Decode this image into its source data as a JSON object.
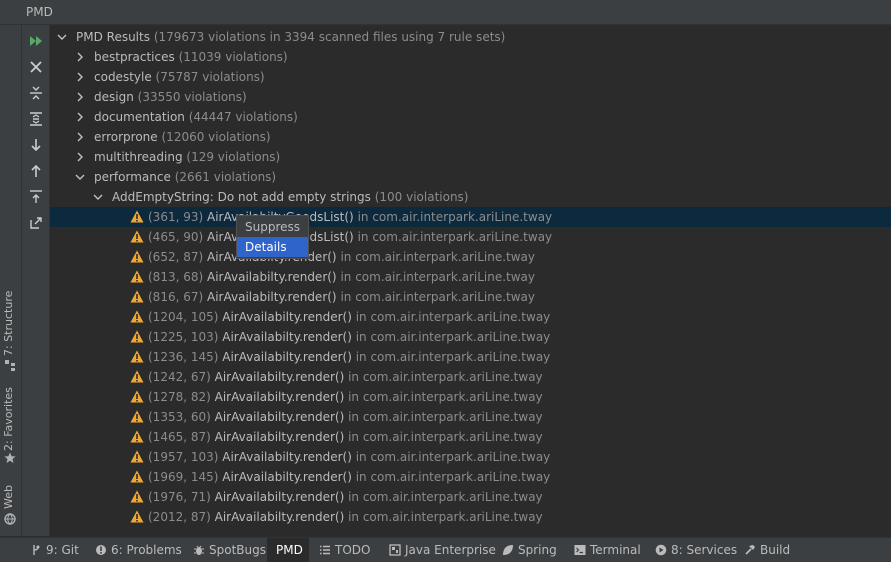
{
  "window": {
    "title": "PMD"
  },
  "left_tabs": [
    {
      "label": "7: Structure",
      "icon": "structure-icon"
    },
    {
      "label": "2: Favorites",
      "icon": "star-icon"
    },
    {
      "label": "Web",
      "icon": "globe-icon"
    }
  ],
  "toolbar": {
    "run": "run-icon",
    "close": "close-icon",
    "collapse": "collapse-all-icon",
    "expand": "expand-all-icon",
    "next": "arrow-down-icon",
    "prev": "arrow-up-icon",
    "export": "export-icon",
    "open": "open-external-icon"
  },
  "tree": {
    "root": {
      "label": "PMD Results",
      "detail": "(179673 violations in 3394 scanned files using 7 rule sets)"
    },
    "categories": [
      {
        "name": "bestpractices",
        "count": "(11039 violations)"
      },
      {
        "name": "codestyle",
        "count": "(75787 violations)"
      },
      {
        "name": "design",
        "count": "(33550 violations)"
      },
      {
        "name": "documentation",
        "count": "(44447 violations)"
      },
      {
        "name": "errorprone",
        "count": "(12060 violations)"
      },
      {
        "name": "multithreading",
        "count": "(129 violations)"
      },
      {
        "name": "performance",
        "count": "(2661 violations)"
      }
    ],
    "rule": {
      "name": "AddEmptyString: Do not add empty strings",
      "count": "(100 violations)"
    },
    "violations": [
      {
        "pos": "(361, 93)",
        "method": "AirAvailabiltyGoodsList()",
        "loc": "in com.air.interpark.ariLine.tway"
      },
      {
        "pos": "(465, 90)",
        "method": "AirAvailabiltyGoodsList()",
        "loc": "in com.air.interpark.ariLine.tway"
      },
      {
        "pos": "(652, 87)",
        "method": "AirAvailabilty.render()",
        "loc": "in com.air.interpark.ariLine.tway"
      },
      {
        "pos": "(813, 68)",
        "method": "AirAvailabilty.render()",
        "loc": "in com.air.interpark.ariLine.tway"
      },
      {
        "pos": "(816, 67)",
        "method": "AirAvailabilty.render()",
        "loc": "in com.air.interpark.ariLine.tway"
      },
      {
        "pos": "(1204, 105)",
        "method": "AirAvailabilty.render()",
        "loc": "in com.air.interpark.ariLine.tway"
      },
      {
        "pos": "(1225, 103)",
        "method": "AirAvailabilty.render()",
        "loc": "in com.air.interpark.ariLine.tway"
      },
      {
        "pos": "(1236, 145)",
        "method": "AirAvailabilty.render()",
        "loc": "in com.air.interpark.ariLine.tway"
      },
      {
        "pos": "(1242, 67)",
        "method": "AirAvailabilty.render()",
        "loc": "in com.air.interpark.ariLine.tway"
      },
      {
        "pos": "(1278, 82)",
        "method": "AirAvailabilty.render()",
        "loc": "in com.air.interpark.ariLine.tway"
      },
      {
        "pos": "(1353, 60)",
        "method": "AirAvailabilty.render()",
        "loc": "in com.air.interpark.ariLine.tway"
      },
      {
        "pos": "(1465, 87)",
        "method": "AirAvailabilty.render()",
        "loc": "in com.air.interpark.ariLine.tway"
      },
      {
        "pos": "(1957, 103)",
        "method": "AirAvailabilty.render()",
        "loc": "in com.air.interpark.ariLine.tway"
      },
      {
        "pos": "(1969, 145)",
        "method": "AirAvailabilty.render()",
        "loc": "in com.air.interpark.ariLine.tway"
      },
      {
        "pos": "(1976, 71)",
        "method": "AirAvailabilty.render()",
        "loc": "in com.air.interpark.ariLine.tway"
      },
      {
        "pos": "(2012, 87)",
        "method": "AirAvailabilty.render()",
        "loc": "in com.air.interpark.ariLine.tway"
      }
    ]
  },
  "context_menu": {
    "suppress": "Suppress",
    "details": "Details"
  },
  "bottom_tabs": [
    {
      "label": "9: Git",
      "icon": "git-icon"
    },
    {
      "label": "6: Problems",
      "icon": "problems-icon"
    },
    {
      "label": "SpotBugs",
      "icon": "bug-icon"
    },
    {
      "label": "PMD",
      "icon": ""
    },
    {
      "label": "TODO",
      "icon": "list-icon"
    },
    {
      "label": "Java Enterprise",
      "icon": "enterprise-icon"
    },
    {
      "label": "Spring",
      "icon": "leaf-icon"
    },
    {
      "label": "Terminal",
      "icon": "terminal-icon"
    },
    {
      "label": "8: Services",
      "icon": "services-icon"
    },
    {
      "label": "Build",
      "icon": "hammer-icon"
    }
  ],
  "colors": {
    "selected_row": "#0d293e",
    "warning": "#f0a732",
    "menu_active": "#2f65ca",
    "run_green": "#59a869"
  }
}
